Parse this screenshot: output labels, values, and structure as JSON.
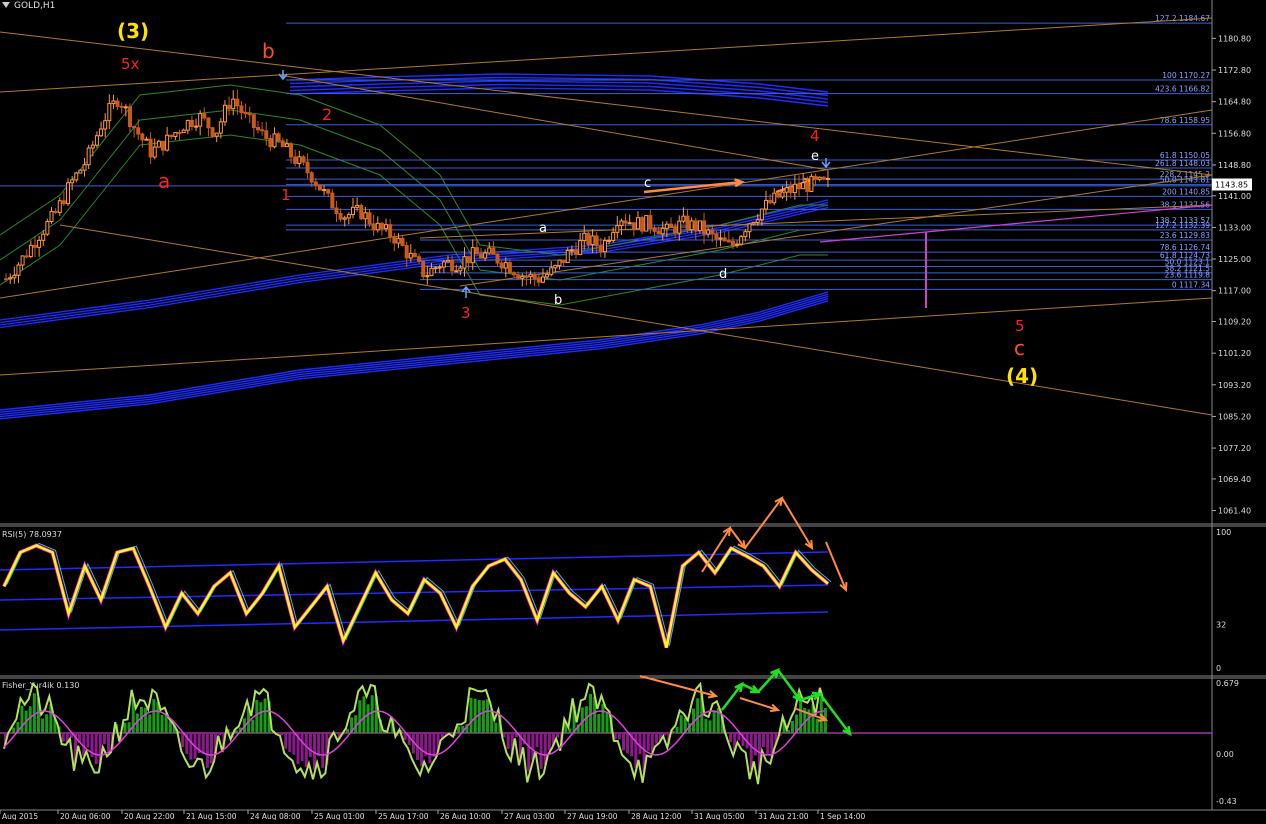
{
  "window": {
    "symbol_title": "GOLD,H1"
  },
  "colors": {
    "background": "#000000",
    "price_line": "#1e2cff",
    "fib_line": "#3b5fd9",
    "trend_line": "#b07a2a",
    "candle_up": "#ff9a3c",
    "candle_down": "#c85a1a",
    "rsi_main": "#ffff00",
    "rsi_shadow": "#ff00ff",
    "fisher_line": "#b4e05a",
    "fisher_signal": "#e040e0",
    "hist_pos": "#1a9a1a",
    "hist_neg": "#8a1a8a",
    "arrow_orange": "#ff8a40",
    "arrow_green": "#20e020",
    "wave_red": "#ff2020",
    "wave_yellow": "#ffe000",
    "wave_white": "#ffffff"
  },
  "chart_data": [
    {
      "type": "candlestick",
      "panel": "price",
      "title": "GOLD,H1",
      "ylim": [
        1058,
        1190
      ],
      "price_axis_ticks": [
        "1180.80",
        "1172.80",
        "1164.80",
        "1156.80",
        "1148.80",
        "1141.00",
        "1133.00",
        "1125.00",
        "1117.00",
        "1109.20",
        "1101.20",
        "1093.20",
        "1085.20",
        "1077.20",
        "1069.40",
        "1061.40"
      ],
      "current_price": "1143.85",
      "time_axis_ticks": [
        "Aug 2015",
        "20 Aug 06:00",
        "20 Aug 22:00",
        "21 Aug 15:00",
        "24 Aug 08:00",
        "25 Aug 01:00",
        "25 Aug 17:00",
        "26 Aug 10:00",
        "27 Aug 03:00",
        "27 Aug 19:00",
        "28 Aug 12:00",
        "31 Aug 05:00",
        "31 Aug 21:00",
        "1 Sep 14:00"
      ],
      "close_path": [
        1120,
        1125,
        1131,
        1136,
        1144,
        1150,
        1160,
        1166,
        1158,
        1152,
        1155,
        1159,
        1161,
        1157,
        1166,
        1160,
        1156,
        1154,
        1150,
        1146,
        1140,
        1136,
        1137,
        1133,
        1131,
        1126,
        1121,
        1124,
        1124,
        1126,
        1126,
        1124,
        1121,
        1120,
        1122,
        1127,
        1130,
        1128,
        1136,
        1134,
        1134,
        1132,
        1134,
        1133,
        1130,
        1128,
        1134,
        1138,
        1141,
        1143,
        1144,
        1144
      ],
      "fib_levels": [
        {
          "label": "127.2 1184.67",
          "price": 1184.67
        },
        {
          "label": "100 1170.27",
          "price": 1170.27
        },
        {
          "label": "423.6 1166.82",
          "price": 1166.82
        },
        {
          "label": "78.6 1158.95",
          "price": 1158.95
        },
        {
          "label": "61.8 1150.05",
          "price": 1150.05
        },
        {
          "label": "261.8 1148.03",
          "price": 1148.03
        },
        {
          "label": "228.2 1145.2",
          "price": 1145.2
        },
        {
          "label": "50.0 1143.81",
          "price": 1143.81
        },
        {
          "label": "200 1140.85",
          "price": 1140.85
        },
        {
          "label": "38.2 1137.56",
          "price": 1137.56
        },
        {
          "label": "138.2 1133.57",
          "price": 1133.57
        },
        {
          "label": "127.2 1132.39",
          "price": 1132.39
        },
        {
          "label": "23.6 1129.83",
          "price": 1129.83
        },
        {
          "label": "78.6 1126.74",
          "price": 1126.74
        },
        {
          "label": "61.8 1124.73",
          "price": 1124.73
        },
        {
          "label": "50.0 1123.1",
          "price": 1123.1
        },
        {
          "label": "38.2 1121.5",
          "price": 1121.5
        },
        {
          "label": "23.6 1119.8",
          "price": 1119.8
        },
        {
          "label": "0 1117.34",
          "price": 1117.34
        }
      ],
      "wave_labels": [
        {
          "text": "(3)",
          "color": "yellow"
        },
        {
          "text": "5x",
          "color": "red"
        },
        {
          "text": "b",
          "color": "orange"
        },
        {
          "text": "2",
          "color": "red"
        },
        {
          "text": "a",
          "color": "red"
        },
        {
          "text": "1",
          "color": "red"
        },
        {
          "text": "3",
          "color": "red"
        },
        {
          "text": "a",
          "color": "white"
        },
        {
          "text": "b",
          "color": "white"
        },
        {
          "text": "c",
          "color": "white"
        },
        {
          "text": "d",
          "color": "white"
        },
        {
          "text": "e",
          "color": "white"
        },
        {
          "text": "4",
          "color": "red"
        },
        {
          "text": "5",
          "color": "red"
        },
        {
          "text": "c",
          "color": "orange"
        },
        {
          "text": "(4)",
          "color": "yellow"
        }
      ]
    },
    {
      "type": "line",
      "panel": "rsi",
      "title": "RSI(5) 78.0937",
      "ylim": [
        0,
        100
      ],
      "axis_ticks": [
        "100",
        "32",
        "0"
      ],
      "series": [
        {
          "name": "RSI(5)",
          "values": [
            60,
            85,
            90,
            85,
            40,
            75,
            50,
            85,
            88,
            60,
            30,
            55,
            40,
            60,
            70,
            40,
            55,
            75,
            30,
            45,
            60,
            20,
            45,
            70,
            50,
            40,
            65,
            55,
            30,
            60,
            75,
            80,
            65,
            35,
            70,
            55,
            45,
            60,
            35,
            65,
            60,
            15,
            75,
            85,
            70,
            88,
            82,
            75,
            60,
            85,
            72,
            62
          ]
        }
      ]
    },
    {
      "type": "bar",
      "panel": "fisher",
      "title": "Fisher_Yur4ik 0.130",
      "ylim": [
        -0.43,
        0.679
      ],
      "axis_ticks": [
        "0.679",
        "0.00",
        "-0.43"
      ]
    }
  ]
}
